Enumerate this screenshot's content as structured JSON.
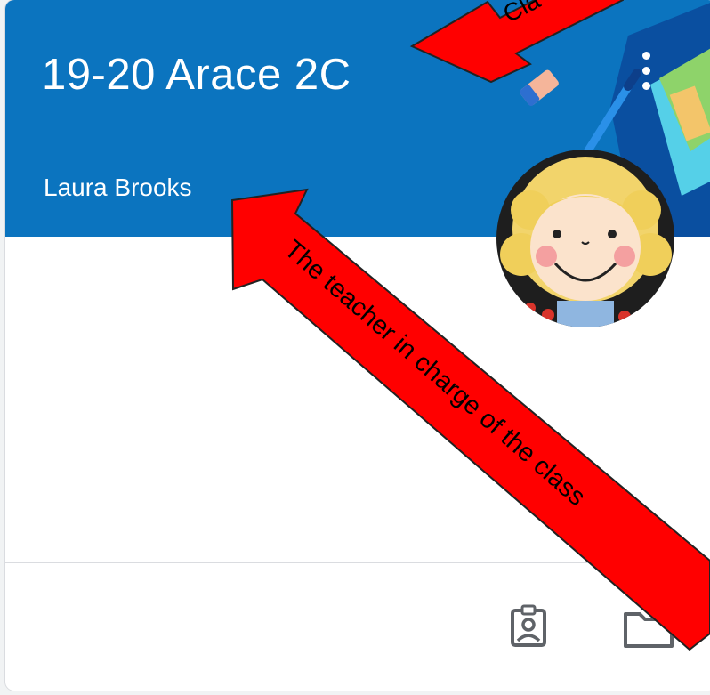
{
  "class_card": {
    "title": "19-20 Arace 2C",
    "teacher": "Laura Brooks"
  },
  "annotations": {
    "top_arrow_text": "Cla",
    "teacher_arrow_text": "The teacher in charge of the class"
  },
  "icons": {
    "more": "more-vert-icon",
    "profile": "assignment-ind-icon",
    "folder": "folder-icon"
  },
  "colors": {
    "banner": "#0b74bf",
    "annotation_arrow": "#ff0000"
  }
}
